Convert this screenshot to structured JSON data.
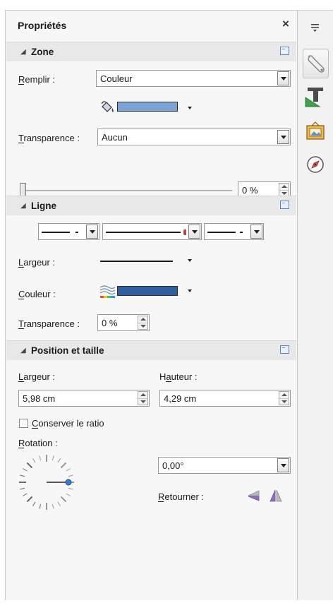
{
  "panel": {
    "title": "Propriétés",
    "close_glyph": "×"
  },
  "zone": {
    "title": "Zone",
    "fill_label": "Remplir :",
    "fill_value": "Couleur",
    "fill_color": "#7ba3d8",
    "transparency_label": "Transparence :",
    "transparency_value": "Aucun",
    "transparency_percent": "0 %",
    "slider_value": 0
  },
  "line": {
    "title": "Ligne",
    "width_label": "Largeur :",
    "color_label": "Couleur :",
    "line_color": "#2f5f9e",
    "transparency_label": "Transparence :",
    "transparency_value": "0 %"
  },
  "position": {
    "title": "Position et taille",
    "width_label": "Largeur :",
    "width_value": "5,98 cm",
    "height_label": "Hauteur :",
    "height_value": "4,29 cm",
    "keep_ratio_label": "Conserver le ratio",
    "keep_ratio_checked": false,
    "rotation_label": "Rotation :",
    "rotation_value": "0,00°",
    "flip_label": "Retourner :"
  },
  "rail": {
    "items": [
      {
        "icon": "menu-icon"
      },
      {
        "icon": "properties-wrench-icon"
      },
      {
        "icon": "styles-icon"
      },
      {
        "icon": "gallery-icon"
      },
      {
        "icon": "navigator-icon"
      }
    ]
  },
  "colors": {
    "accent": "#3a78c9",
    "panel_bg": "#f7f7f7",
    "section_bg": "#e8e8e8"
  }
}
